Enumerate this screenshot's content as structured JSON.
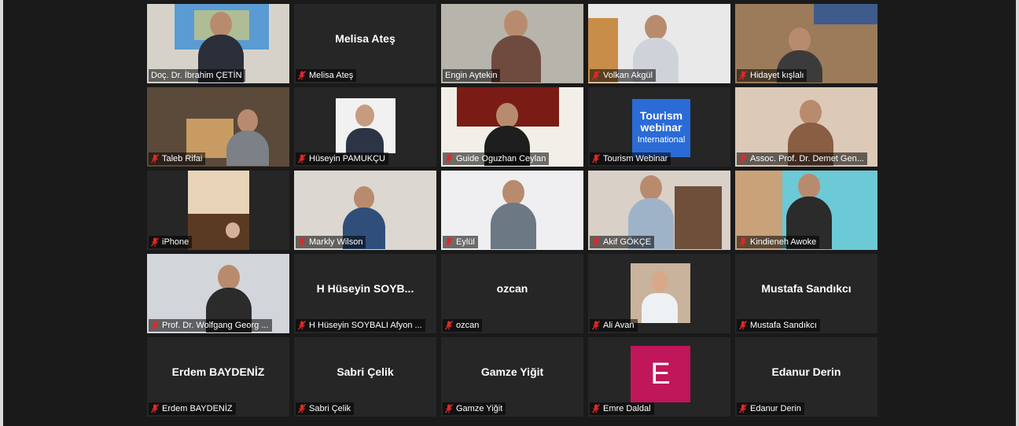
{
  "meeting": {
    "participants": [
      {
        "name": "Doç. Dr. İbrahim ÇETİN",
        "display": "",
        "video": "map",
        "muted": false
      },
      {
        "name": "Melisa Ateş",
        "display": "Melisa Ateş",
        "video": "none",
        "muted": true
      },
      {
        "name": "Engin Aytekin",
        "display": "",
        "video": "room",
        "muted": false,
        "speaking": true
      },
      {
        "name": "Volkan Akgül",
        "display": "",
        "video": "office",
        "muted": true
      },
      {
        "name": "Hidayet kışlalı",
        "display": "",
        "video": "shelf",
        "muted": true
      },
      {
        "name": "Taleb Rifai",
        "display": "",
        "video": "library",
        "muted": true
      },
      {
        "name": "Hüseyin PAMUKÇU",
        "display": "",
        "video": "photo",
        "muted": true
      },
      {
        "name": "Guide Oguzhan Ceylan",
        "display": "",
        "video": "red-wall",
        "muted": true
      },
      {
        "name": "Tourism Webinar",
        "display": "",
        "video": "logo",
        "muted": true,
        "logo_line1": "Tourism",
        "logo_line2": "webinar",
        "logo_line3": "International"
      },
      {
        "name": "Assoc. Prof. Dr. Demet Gen...",
        "display": "",
        "video": "warm",
        "muted": true
      },
      {
        "name": "iPhone",
        "display": "",
        "video": "phone",
        "muted": true
      },
      {
        "name": "Markly Wilson",
        "display": "",
        "video": "headset",
        "muted": true
      },
      {
        "name": "Eylül",
        "display": "",
        "video": "bright",
        "muted": true
      },
      {
        "name": "Akif GÖKÇE",
        "display": "",
        "video": "bookcase",
        "muted": true
      },
      {
        "name": "Kindieneh Awoke",
        "display": "",
        "video": "teal",
        "muted": true
      },
      {
        "name": "Prof. Dr. Wolfgang Georg ...",
        "display": "",
        "video": "chair",
        "muted": true
      },
      {
        "name": "H Hüseyin SOYBALI Afyon ...",
        "display": "H Hüseyin SOYB...",
        "video": "none",
        "muted": true
      },
      {
        "name": "ozcan",
        "display": "ozcan",
        "video": "none",
        "muted": true
      },
      {
        "name": "Ali Avan",
        "display": "",
        "video": "photo2",
        "muted": true
      },
      {
        "name": "Mustafa Sandıkcı",
        "display": "Mustafa Sandıkcı",
        "video": "none",
        "muted": true
      },
      {
        "name": "Erdem BAYDENİZ",
        "display": "Erdem BAYDENİZ",
        "video": "none",
        "muted": true
      },
      {
        "name": "Sabri Çelik",
        "display": "Sabri Çelik",
        "video": "none",
        "muted": true
      },
      {
        "name": "Gamze Yiğit",
        "display": "Gamze Yiğit",
        "video": "none",
        "muted": true
      },
      {
        "name": "Emre Daldal",
        "display": "",
        "video": "letter",
        "muted": true,
        "letter": "E"
      },
      {
        "name": "Edanur Derin",
        "display": "Edanur Derin",
        "video": "none",
        "muted": true
      }
    ]
  },
  "colors": {
    "speaking_border": "#c9d34a",
    "mute_icon": "#e02828",
    "letter_avatar": "#c0165a",
    "tile_bg": "#262626"
  }
}
